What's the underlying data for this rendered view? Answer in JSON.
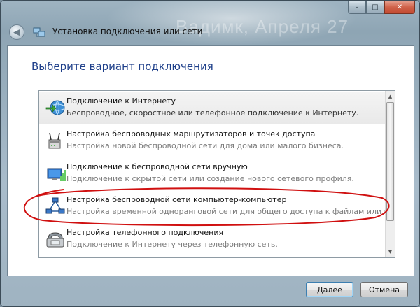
{
  "window": {
    "title": "Установка подключения или сети",
    "background_text": "Вадимк, Апреля 27",
    "caption_minimize": "–",
    "caption_maximize": "□",
    "caption_close": "✕"
  },
  "heading": "Выберите вариант подключения",
  "options": [
    {
      "title": "Подключение к Интернету",
      "description": "Беспроводное, скоростное или телефонное подключение к Интернету.",
      "icon": "globe-connection-icon",
      "selected": true
    },
    {
      "title": "Настройка беспроводных маршрутизаторов и точек доступа",
      "description": "Настройка новой беспроводной сети для дома или малого бизнеса.",
      "icon": "wireless-router-icon",
      "selected": false
    },
    {
      "title": "Подключение к беспроводной сети вручную",
      "description": "Подключение к скрытой сети или создание нового сетевого профиля.",
      "icon": "wireless-network-icon",
      "selected": false
    },
    {
      "title": "Настройка беспроводной сети компьютер-компьютер",
      "description": "Настройка временной одноранговой сети для общего доступа к файлам или к Инт...",
      "icon": "adhoc-network-icon",
      "selected": false
    },
    {
      "title": "Настройка телефонного подключения",
      "description": "Подключение к Интернету через телефонную сеть.",
      "icon": "telephone-modem-icon",
      "selected": false
    }
  ],
  "buttons": {
    "next": "Далее",
    "cancel": "Отмена"
  },
  "colors": {
    "heading": "#1e3f8a",
    "annotation": "#d01010",
    "description": "#7c7c7c"
  }
}
